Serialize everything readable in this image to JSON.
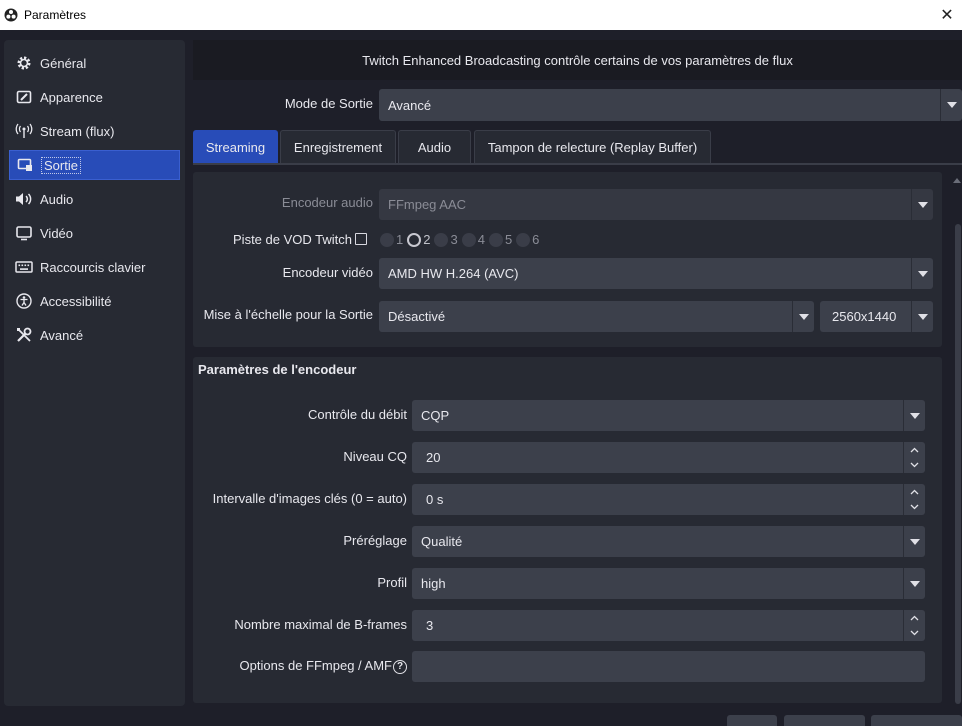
{
  "window": {
    "title": "Paramètres",
    "close_glyph": "✕"
  },
  "sidebar": {
    "items": [
      {
        "label": "Général",
        "icon": "gear-icon"
      },
      {
        "label": "Apparence",
        "icon": "appearance-icon"
      },
      {
        "label": "Stream (flux)",
        "icon": "broadcast-icon"
      },
      {
        "label": "Sortie",
        "icon": "output-icon",
        "active": true
      },
      {
        "label": "Audio",
        "icon": "speaker-icon"
      },
      {
        "label": "Vidéo",
        "icon": "monitor-icon"
      },
      {
        "label": "Raccourcis clavier",
        "icon": "keyboard-icon"
      },
      {
        "label": "Accessibilité",
        "icon": "accessibility-icon"
      },
      {
        "label": "Avancé",
        "icon": "tools-icon"
      }
    ]
  },
  "banner": {
    "text": "Twitch Enhanced Broadcasting contrôle certains de vos paramètres de flux"
  },
  "output_mode": {
    "label": "Mode de Sortie",
    "value": "Avancé"
  },
  "tabs": [
    {
      "label": "Streaming",
      "active": true
    },
    {
      "label": "Enregistrement"
    },
    {
      "label": "Audio"
    },
    {
      "label": "Tampon de relecture (Replay Buffer)"
    }
  ],
  "streaming": {
    "audio_encoder": {
      "label": "Encodeur audio",
      "value": "FFmpeg AAC"
    },
    "vod_track": {
      "label": "Piste de VOD Twitch",
      "tracks": [
        "1",
        "2",
        "3",
        "4",
        "5",
        "6"
      ],
      "selected": "2"
    },
    "video_encoder": {
      "label": "Encodeur vidéo",
      "value": "AMD HW H.264 (AVC)"
    },
    "rescale": {
      "label": "Mise à l'échelle pour la Sortie",
      "value": "Désactivé",
      "resolution": "2560x1440"
    }
  },
  "encoder_settings": {
    "title": "Paramètres de l'encodeur",
    "rate_control": {
      "label": "Contrôle du débit",
      "value": "CQP"
    },
    "cq_level": {
      "label": "Niveau CQ",
      "value": "20"
    },
    "keyframe_interval": {
      "label": "Intervalle d'images clés (0 = auto)",
      "value": "0 s"
    },
    "preset": {
      "label": "Préréglage",
      "value": "Qualité"
    },
    "profile": {
      "label": "Profil",
      "value": "high"
    },
    "max_bframes": {
      "label": "Nombre maximal de B-frames",
      "value": "3"
    },
    "ffmpeg_options": {
      "label": "Options de FFmpeg / AMF",
      "value": ""
    }
  },
  "colors": {
    "accent": "#284cb8",
    "background": "#1e1f29",
    "panel": "#272a33",
    "input": "#3c404b"
  }
}
